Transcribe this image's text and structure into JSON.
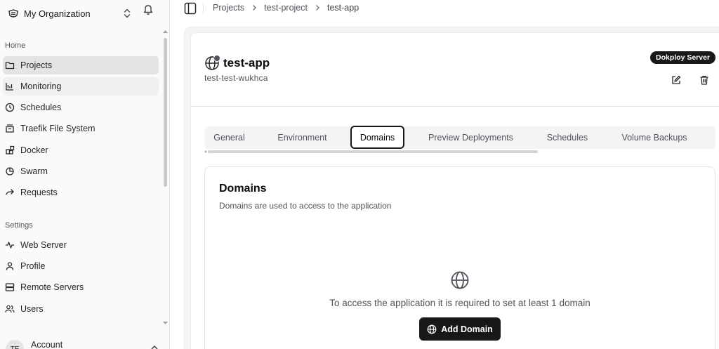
{
  "org": {
    "name": "My Organization"
  },
  "sidebar": {
    "home_label": "Home",
    "home_items": [
      {
        "label": "Projects",
        "icon": "folder-icon"
      },
      {
        "label": "Monitoring",
        "icon": "chart-icon"
      },
      {
        "label": "Schedules",
        "icon": "clock-icon"
      },
      {
        "label": "Traefik File System",
        "icon": "file-system-icon"
      },
      {
        "label": "Docker",
        "icon": "blocks-icon"
      },
      {
        "label": "Swarm",
        "icon": "pie-icon"
      },
      {
        "label": "Requests",
        "icon": "arrow-right-icon"
      }
    ],
    "settings_label": "Settings",
    "settings_items": [
      {
        "label": "Web Server",
        "icon": "activity-icon"
      },
      {
        "label": "Profile",
        "icon": "user-icon"
      },
      {
        "label": "Remote Servers",
        "icon": "server-icon"
      },
      {
        "label": "Users",
        "icon": "users-icon"
      }
    ],
    "account": {
      "label": "Account",
      "initials": "TE"
    }
  },
  "breadcrumb": [
    "Projects",
    "test-project",
    "test-app"
  ],
  "app": {
    "title": "test-app",
    "subtitle": "test-test-wukhca",
    "server_badge": "Dokploy Server"
  },
  "tabs": [
    "General",
    "Environment",
    "Domains",
    "Preview Deployments",
    "Schedules",
    "Volume Backups"
  ],
  "active_tab": "Domains",
  "domains": {
    "title": "Domains",
    "description": "Domains are used to access to the application",
    "empty_text": "To access the application it is required to set at least 1 domain",
    "add_button": "Add Domain"
  },
  "colors": {
    "primary": "#18181b",
    "sidebar_bg": "#fafafa",
    "active_item": "#e4e4e7"
  }
}
